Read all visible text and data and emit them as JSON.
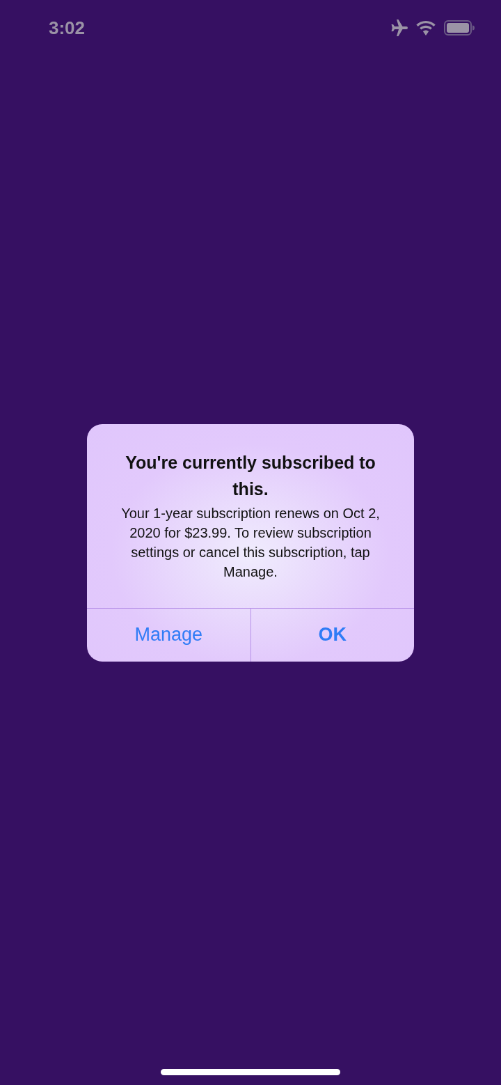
{
  "status_bar": {
    "time": "3:02",
    "airplane_mode": true
  },
  "alert": {
    "title": "You're currently subscribed to this.",
    "message": "Your 1-year subscription renews on Oct 2, 2020 for $23.99. To review subscription settings or cancel this subscription, tap Manage.",
    "buttons": [
      {
        "label": "Manage",
        "preferred": false
      },
      {
        "label": "OK",
        "preferred": true
      }
    ]
  }
}
